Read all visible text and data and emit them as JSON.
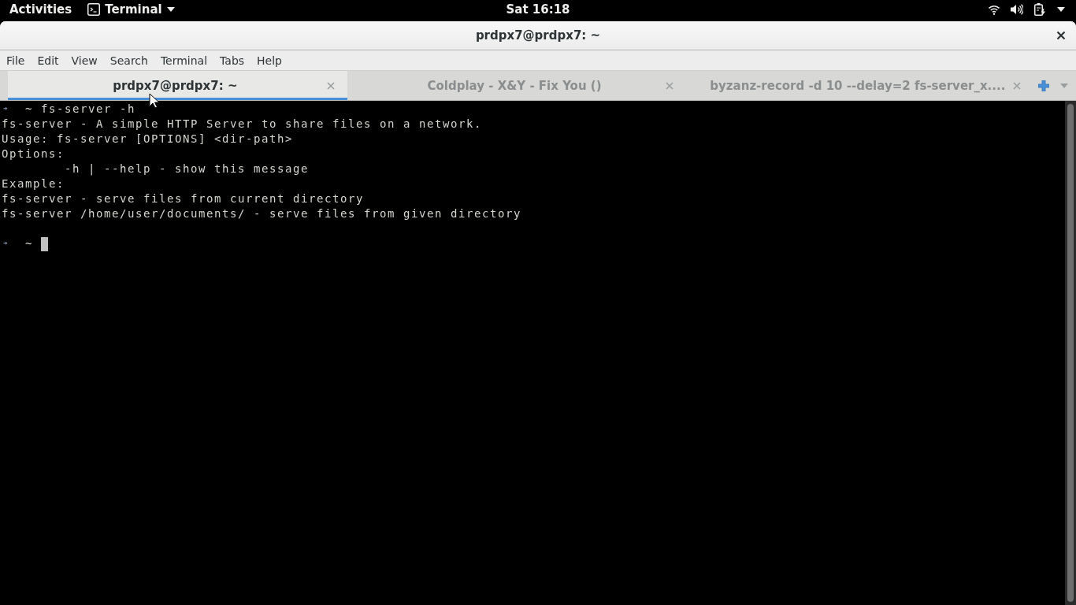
{
  "top_bar": {
    "activities": "Activities",
    "app_menu": "Terminal",
    "clock": "Sat 16:18"
  },
  "window": {
    "title": "prdpx7@prdpx7: ~"
  },
  "menu_bar": [
    "File",
    "Edit",
    "View",
    "Search",
    "Terminal",
    "Tabs",
    "Help"
  ],
  "tabs": [
    {
      "label": "prdpx7@prdpx7: ~",
      "selected": true
    },
    {
      "label": "Coldplay - X&Y - Fix You ()",
      "selected": false
    },
    {
      "label": "byzanz-record -d 10 --delay=2 fs-server_x....",
      "selected": false
    }
  ],
  "terminal": {
    "lines": [
      {
        "kind": "prompt",
        "arrow": "➜",
        "dir": "~",
        "command": "fs-server -h"
      },
      {
        "kind": "output",
        "text": "fs-server - A simple HTTP Server to share files on a network."
      },
      {
        "kind": "output",
        "text": "Usage: fs-server [OPTIONS] <dir-path>"
      },
      {
        "kind": "output",
        "text": "Options:"
      },
      {
        "kind": "indented",
        "text": "-h | --help - show this message"
      },
      {
        "kind": "output",
        "text": "Example:"
      },
      {
        "kind": "output",
        "text": "fs-server - serve files from current directory"
      },
      {
        "kind": "output",
        "text": "fs-server /home/user/documents/ - serve files from given directory"
      },
      {
        "kind": "blank"
      },
      {
        "kind": "prompt",
        "arrow": "➜",
        "dir": "~",
        "cursor": true
      }
    ]
  }
}
